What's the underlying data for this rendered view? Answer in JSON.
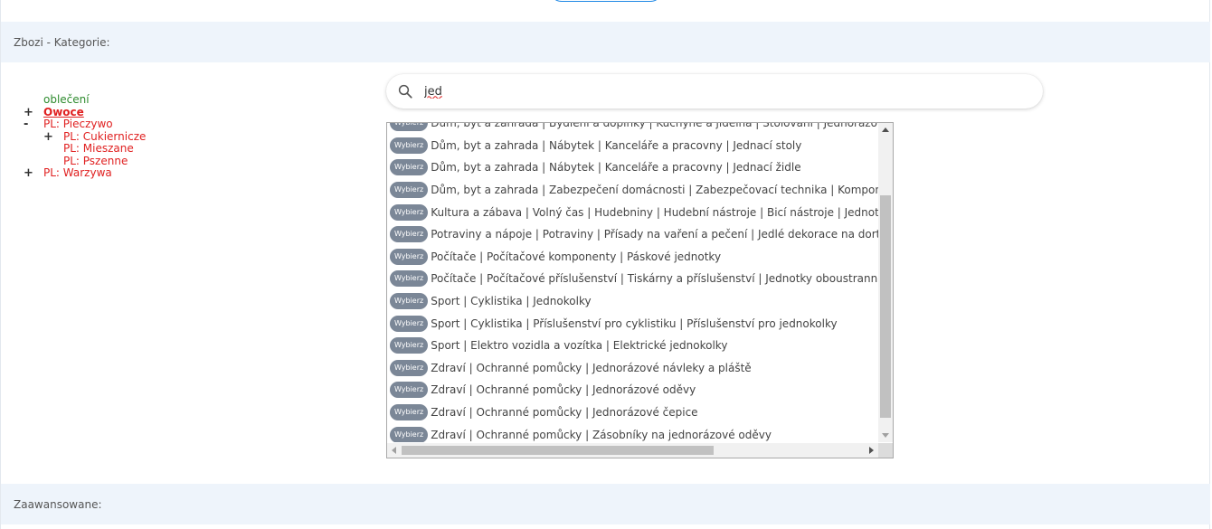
{
  "sections": {
    "category_header": "Zbozi - Kategorie:",
    "advanced_header": "Zaawansowane:"
  },
  "tree": [
    {
      "toggle": "",
      "indent": 0,
      "label": "oblečení",
      "color": "green",
      "bold": false
    },
    {
      "toggle": "+",
      "indent": 0,
      "label": "Owoce",
      "color": "red",
      "bold": true
    },
    {
      "toggle": "-",
      "indent": 0,
      "label": "PL: Pieczywo",
      "color": "red",
      "bold": false
    },
    {
      "toggle": "+",
      "indent": 1,
      "label": "PL: Cukiernicze",
      "color": "red",
      "bold": false
    },
    {
      "toggle": "",
      "indent": 1,
      "label": "PL: Mieszane",
      "color": "red",
      "bold": false
    },
    {
      "toggle": "",
      "indent": 1,
      "label": "PL: Pszenne",
      "color": "red",
      "bold": false
    },
    {
      "toggle": "+",
      "indent": 0,
      "label": "PL: Warzywa",
      "color": "red",
      "bold": false
    }
  ],
  "search": {
    "value": "jed",
    "icon": "search-icon"
  },
  "choose_label": "Wybierz",
  "results": [
    "Dům, byt a zahrada | Bydlení a doplňky | Kuchyně a jídelna | Stolování | Jednorázové",
    "Dům, byt a zahrada | Nábytek | Kanceláře a pracovny | Jednací stoly",
    "Dům, byt a zahrada | Nábytek | Kanceláře a pracovny | Jednací židle",
    "Dům, byt a zahrada | Zabezpečení domácnosti | Zabezpečovací technika | Komponenty",
    "Kultura a zábava | Volný čas | Hudebniny | Hudební nástroje | Bicí nástroje | Jednotlivé",
    "Potraviny a nápoje | Potraviny | Přísady na vaření a pečení | Jedlé dekorace na dorty",
    "Počítače | Počítačové komponenty | Páskové jednotky",
    "Počítače | Počítačové příslušenství | Tiskárny a příslušenství | Jednotky oboustranného",
    "Sport | Cyklistika | Jednokolky",
    "Sport | Cyklistika | Příslušenství pro cyklistiku | Příslušenství pro jednokolky",
    "Sport | Elektro vozidla a vozítka | Elektrické jednokolky",
    "Zdraví | Ochranné pomůcky | Jednorázové návleky a pláště",
    "Zdraví | Ochranné pomůcky | Jednorázové oděvy",
    "Zdraví | Ochranné pomůcky | Jednorázové čepice",
    "Zdraví | Ochranné pomůcky | Zásobníky na jednorázové oděvy"
  ],
  "colors": {
    "section_bg": "#eef4fb",
    "choose_button": "#7b8797",
    "tree_green": "#2e8b2e",
    "tree_red": "#e02020"
  }
}
